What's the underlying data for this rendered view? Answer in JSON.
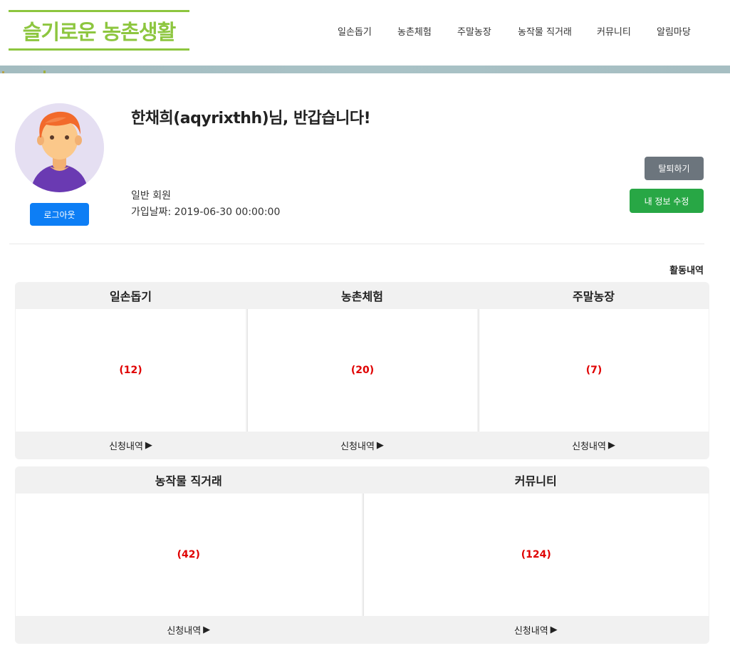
{
  "brand": {
    "logo_text": "슬기로운 농촌생활",
    "logo_color": "#8dc63f"
  },
  "nav": {
    "items": [
      "일손돕기",
      "농촌체험",
      "주말농장",
      "농작물 직거래",
      "커뮤니티",
      "알림마당"
    ]
  },
  "profile": {
    "greeting": "한채희(aqyrixthh)님, 반갑습니다!",
    "member_type": "일반 회원",
    "join_date": "가입날짜: 2019-06-30 00:00:00",
    "logout_label": "로그아웃",
    "withdraw_label": "탈퇴하기",
    "edit_label": "내 정보 수정",
    "avatar_icon": "user-avatar-icon"
  },
  "activity": {
    "title": "활동내역",
    "link_label": "신청내역",
    "cards": [
      {
        "title": "일손돕기",
        "count": "(12)"
      },
      {
        "title": "농촌체험",
        "count": "(20)"
      },
      {
        "title": "주말농장",
        "count": "(7)"
      },
      {
        "title": "농작물 직거래",
        "count": "(42)"
      },
      {
        "title": "커뮤니티",
        "count": "(124)"
      }
    ]
  },
  "colors": {
    "primary": "#0d7ef5",
    "secondary": "#6c757d",
    "success": "#28a745",
    "count": "#e00000"
  }
}
